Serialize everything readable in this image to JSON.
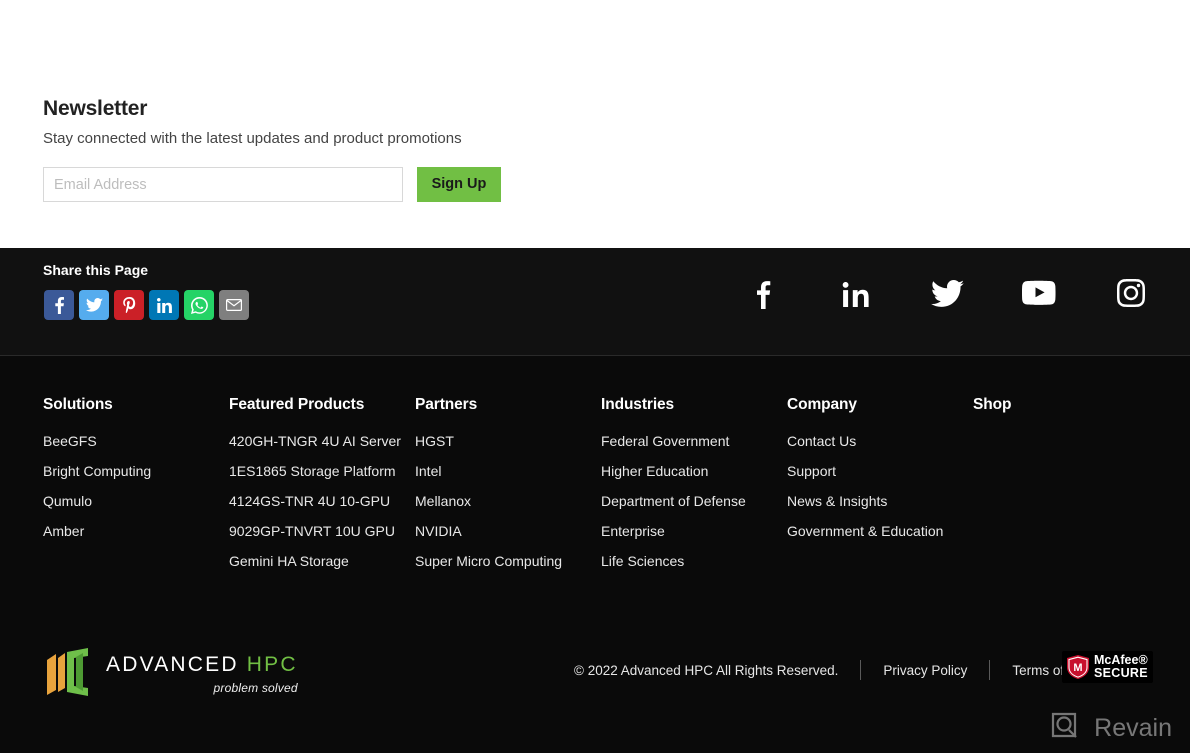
{
  "newsletter": {
    "title": "Newsletter",
    "subtitle": "Stay connected with the latest updates and product promotions",
    "email_placeholder": "Email Address",
    "email_value": "",
    "signup_label": "Sign Up",
    "accent_color": "#71bf44"
  },
  "share": {
    "title": "Share this Page",
    "buttons": [
      {
        "name": "facebook",
        "color": "#3b5998"
      },
      {
        "name": "twitter",
        "color": "#55acee"
      },
      {
        "name": "pinterest",
        "color": "#cb2027"
      },
      {
        "name": "linkedin",
        "color": "#0077b5"
      },
      {
        "name": "whatsapp",
        "color": "#25d366"
      },
      {
        "name": "email",
        "color": "#7f7f7f"
      }
    ],
    "social": [
      "facebook",
      "linkedin",
      "twitter",
      "youtube",
      "instagram"
    ]
  },
  "footer": {
    "columns": [
      {
        "heading": "Solutions",
        "links": [
          "BeeGFS",
          "Bright Computing",
          "Qumulo",
          "Amber"
        ]
      },
      {
        "heading": "Featured Products",
        "links": [
          "420GH-TNGR 4U AI Server",
          "1ES1865 Storage Platform",
          "4124GS-TNR 4U 10-GPU",
          "9029GP-TNVRT 10U GPU",
          "Gemini HA Storage"
        ]
      },
      {
        "heading": "Partners",
        "links": [
          "HGST",
          "Intel",
          "Mellanox",
          "NVIDIA",
          "Super Micro Computing"
        ]
      },
      {
        "heading": "Industries",
        "links": [
          "Federal Government",
          "Higher Education",
          "Department of Defense",
          "Enterprise",
          "Life Sciences"
        ]
      },
      {
        "heading": "Company",
        "links": [
          "Contact Us",
          "Support",
          "News & Insights",
          "Government & Education"
        ]
      },
      {
        "heading": "Shop",
        "links": []
      }
    ],
    "brand": {
      "word_primary": "ADVANCED",
      "word_accent": "HPC",
      "tagline": "problem solved",
      "accent_color": "#71bf44"
    },
    "copyright": "© 2022 Advanced HPC All Rights Reserved.",
    "privacy_label": "Privacy Policy",
    "terms_label": "Terms of Use",
    "mcafee": {
      "line1": "McAfee®",
      "line2": "SECURE",
      "badge_color": "#c8102e"
    }
  },
  "watermark": {
    "label": "Revain"
  }
}
